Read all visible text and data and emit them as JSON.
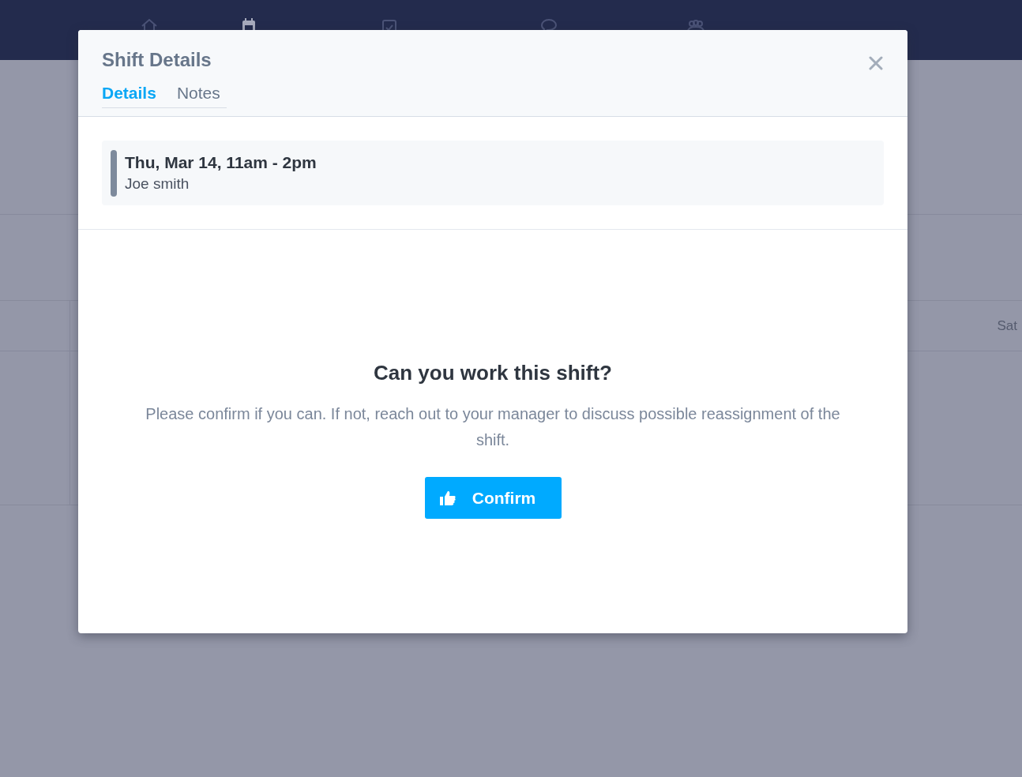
{
  "calendar": {
    "day_header": "Sat"
  },
  "modal": {
    "title": "Shift Details",
    "tabs": [
      {
        "label": "Details",
        "selected": true
      },
      {
        "label": "Notes",
        "selected": false
      }
    ],
    "shift": {
      "time": "Thu, Mar 14, 11am - 2pm",
      "employee": "Joe smith"
    },
    "question": "Can you work this shift?",
    "message": "Please confirm if you can. If not, reach out to your manager to discuss possible reassignment of the shift.",
    "button": "Confirm"
  }
}
